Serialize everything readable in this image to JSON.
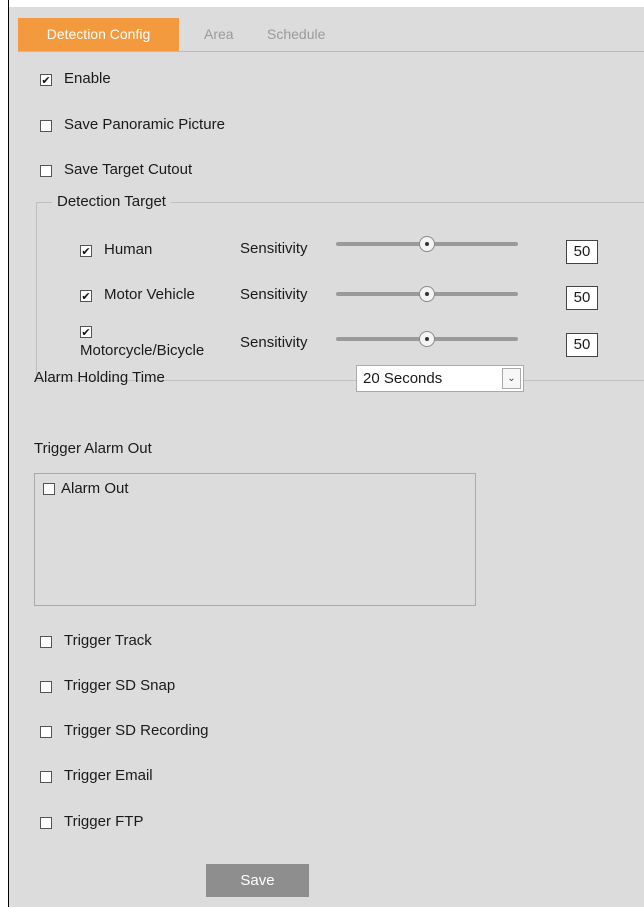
{
  "tabs": [
    {
      "label": "Detection Config",
      "active": true
    },
    {
      "label": "Area",
      "active": false
    },
    {
      "label": "Schedule",
      "active": false
    }
  ],
  "options": {
    "enable": {
      "label": "Enable",
      "checked": true
    },
    "save_panoramic": {
      "label": "Save Panoramic Picture",
      "checked": false
    },
    "save_cutout": {
      "label": "Save Target Cutout",
      "checked": false
    }
  },
  "detection_target": {
    "title": "Detection Target",
    "sensitivity_label": "Sensitivity",
    "targets": [
      {
        "label": "Human",
        "checked": true,
        "value": "50"
      },
      {
        "label": "Motor Vehicle",
        "checked": true,
        "value": "50"
      },
      {
        "label": "Motorcycle/Bicycle",
        "checked": true,
        "value": "50"
      }
    ]
  },
  "alarm_holding": {
    "label": "Alarm Holding Time",
    "value": "20 Seconds"
  },
  "trigger_alarm_out": {
    "label": "Trigger Alarm Out",
    "item": "Alarm Out",
    "checked": false
  },
  "triggers": [
    {
      "label": "Trigger Track",
      "checked": false
    },
    {
      "label": "Trigger SD Snap",
      "checked": false
    },
    {
      "label": "Trigger SD Recording",
      "checked": false
    },
    {
      "label": "Trigger Email",
      "checked": false
    },
    {
      "label": "Trigger FTP",
      "checked": false
    }
  ],
  "save_label": "Save",
  "colors": {
    "accent": "#f39a3e",
    "panel": "#dcdcdc",
    "button": "#8e8e8e"
  }
}
